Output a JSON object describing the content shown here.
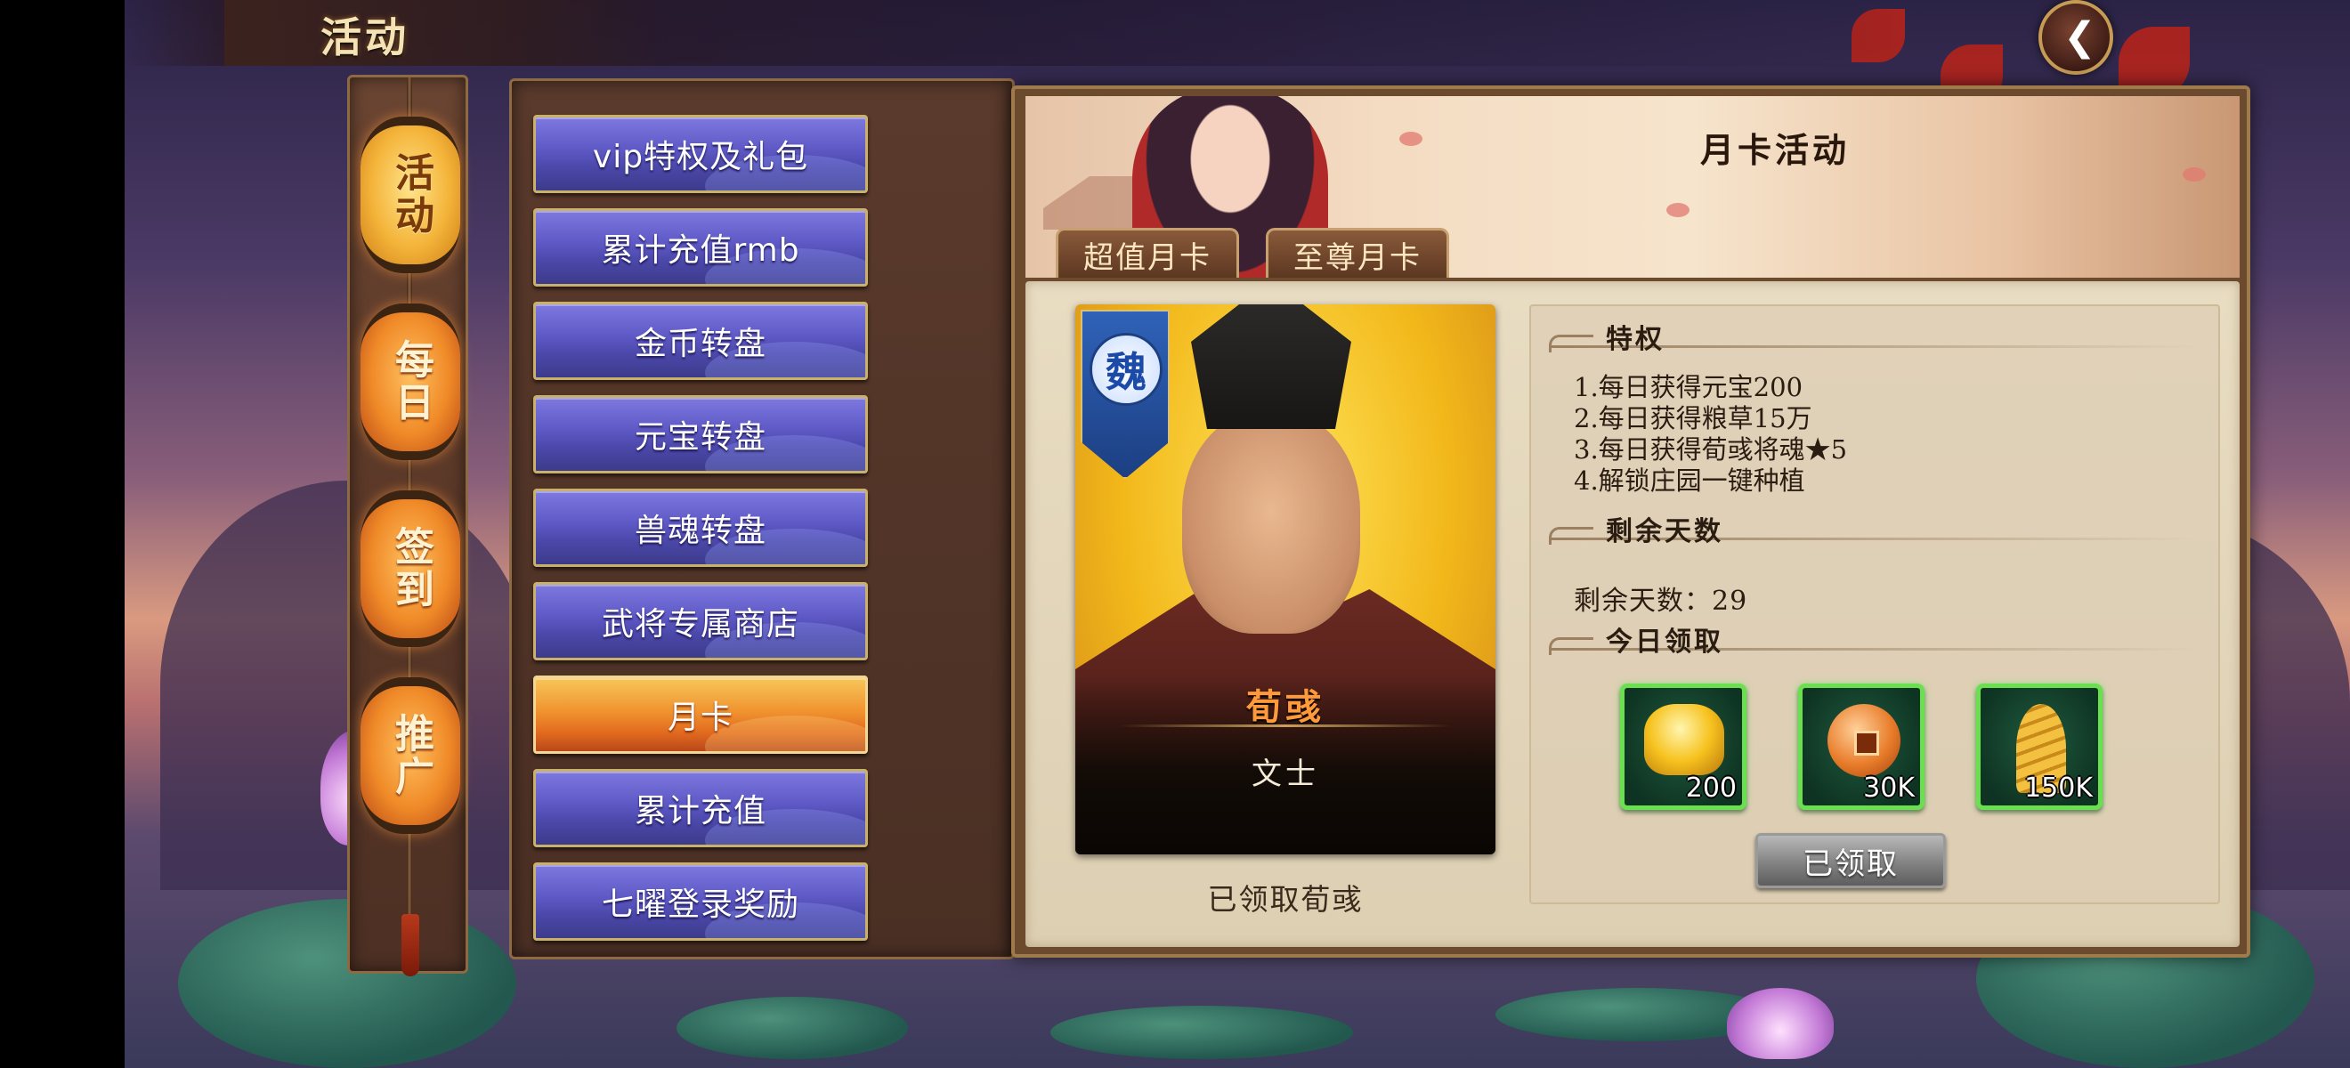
{
  "header": {
    "title": "活动",
    "back_icon": "chevron-left-icon"
  },
  "category_tabs": [
    {
      "label": "活动",
      "active": true
    },
    {
      "label": "每日",
      "active": false
    },
    {
      "label": "签到",
      "active": false
    },
    {
      "label": "推广",
      "active": false
    }
  ],
  "menu": [
    {
      "label": "vip特权及礼包",
      "active": false
    },
    {
      "label": "累计充值rmb",
      "active": false
    },
    {
      "label": "金币转盘",
      "active": false
    },
    {
      "label": "元宝转盘",
      "active": false
    },
    {
      "label": "兽魂转盘",
      "active": false
    },
    {
      "label": "武将专属商店",
      "active": false
    },
    {
      "label": "月卡",
      "active": true
    },
    {
      "label": "累计充值",
      "active": false
    },
    {
      "label": "七曜登录奖励",
      "active": false
    }
  ],
  "banner": {
    "title": "月卡活动"
  },
  "sub_tabs": [
    {
      "label": "超值月卡"
    },
    {
      "label": "至尊月卡"
    }
  ],
  "hero": {
    "faction": "魏",
    "name": "荀彧",
    "class": "文士",
    "status": "已领取荀彧"
  },
  "privileges": {
    "heading": "特权",
    "items": [
      "1.每日获得元宝200",
      "2.每日获得粮草15万",
      "3.每日获得荀彧将魂★5",
      "4.解锁庄园一键种植"
    ]
  },
  "remaining_days": {
    "heading": "剩余天数",
    "text": "剩余天数：29"
  },
  "daily_claim": {
    "heading": "今日领取",
    "rewards": [
      {
        "icon": "gold-ingot-icon",
        "quantity": "200"
      },
      {
        "icon": "copper-coin-icon",
        "quantity": "30K"
      },
      {
        "icon": "grain-icon",
        "quantity": "150K"
      }
    ],
    "button_label": "已领取"
  },
  "colors": {
    "active_menu": "#f09430",
    "menu": "#5d58c4",
    "reward_border": "#6ae050",
    "claimed_button": "#8a8a8a"
  }
}
